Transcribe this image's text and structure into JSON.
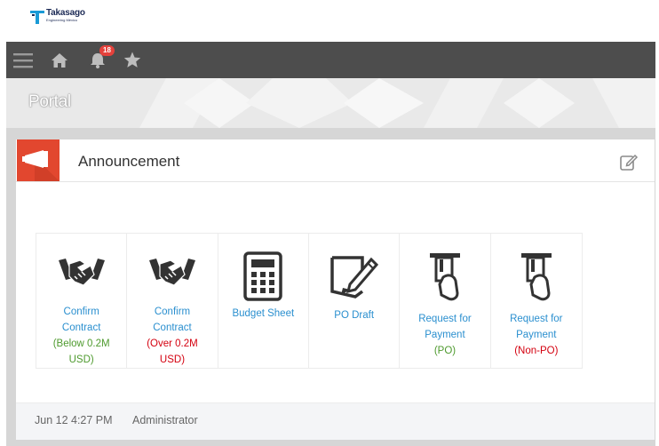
{
  "brand": {
    "name": "Takasago",
    "subtitle": "Engineering México"
  },
  "nav": {
    "notification_count": "18"
  },
  "page": {
    "title": "Portal"
  },
  "announcement": {
    "title": "Announcement",
    "tiles": [
      {
        "label": "Confirm Contract",
        "sub": "(Below 0.2M USD)",
        "icon": "handshake-icon"
      },
      {
        "label": "Confirm Contract",
        "sub": "(Over 0.2M USD)",
        "icon": "handshake-icon"
      },
      {
        "label": "Budget Sheet",
        "sub": "",
        "icon": "calculator-icon"
      },
      {
        "label": "PO Draft",
        "sub": "",
        "icon": "document-pen-icon"
      },
      {
        "label": "Request for Payment",
        "sub": "(PO)",
        "icon": "card-payment-icon"
      },
      {
        "label": "Request for Payment",
        "sub": "(Non-PO)",
        "icon": "card-payment-icon"
      }
    ],
    "footer": {
      "date": "Jun 12 4:27 PM",
      "author": "Administrator"
    }
  },
  "colors": {
    "navbar": "#4d4d4d",
    "accent_red": "#e2472f",
    "link_blue": "#2a8fcf",
    "green": "#4e9a2e",
    "red": "#d4000f",
    "badge": "#e5413b"
  }
}
